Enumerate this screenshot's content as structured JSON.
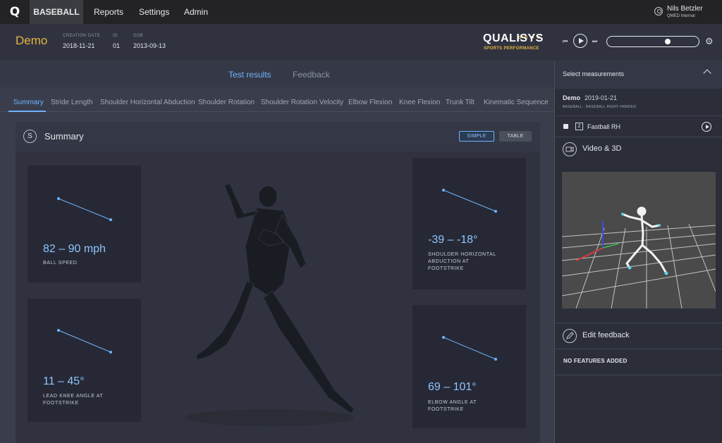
{
  "nav": {
    "logo": "Q",
    "items": [
      "BASEBALL",
      "Reports",
      "Settings",
      "Admin"
    ],
    "user_name": "Nils Betzler",
    "user_org": "QMED Internal"
  },
  "header": {
    "title": "Demo",
    "meta": [
      {
        "label": "CREATION DATE",
        "value": "2018-11-21"
      },
      {
        "label": "ID",
        "value": "01"
      },
      {
        "label": "DOB",
        "value": "2013-09-13"
      }
    ],
    "brand": "QUALISYS",
    "brand_sub": "SPORTS PERFORMANCE",
    "playback_position": 0.68
  },
  "tabs": [
    "Test results",
    "Feedback"
  ],
  "subtabs": [
    "Summary",
    "Stride Length",
    "Shoulder Horizontal Abduction",
    "Shoulder Rotation",
    "Shoulder Rotation Velocity",
    "Elbow Flexion",
    "Knee Flexion",
    "Trunk Tilt",
    "Kinematic Sequence"
  ],
  "summary": {
    "badge": "S",
    "title": "Summary",
    "view_simple": "SIMPLE",
    "view_table": "TABLE",
    "cards": [
      {
        "value": "82 – 90 mph",
        "label_lines": [
          "BALL SPEED"
        ]
      },
      {
        "value": "11 – 45°",
        "label_lines": [
          "LEAD KNEE ANGLE AT",
          "FOOTSTRIKE"
        ]
      },
      {
        "value": "-39 – -18°",
        "label_lines": [
          "SHOULDER HORIZONTAL",
          "ABDUCTION AT",
          "FOOTSTRIKE"
        ]
      },
      {
        "value": "69 – 101°",
        "label_lines": [
          "ELBOW ANGLE AT",
          "FOOTSTRIKE"
        ]
      }
    ]
  },
  "side": {
    "title": "Select measurements",
    "session_name": "Demo",
    "session_date": "2019-01-21",
    "session_sub": "BASEBALL - BASEBALL RIGHT-HANDED",
    "measurement_number": "2",
    "measurement_name": "Fastball RH",
    "video_title": "Video & 3D",
    "edit_title": "Edit feedback",
    "no_features": "NO FEATURES ADDED"
  },
  "colors": {
    "accent": "#6fb2ff",
    "brand_yellow": "#e3b443",
    "nav_bg": "#232326",
    "panel_bg": "#30333f",
    "card_bg": "#262935"
  }
}
